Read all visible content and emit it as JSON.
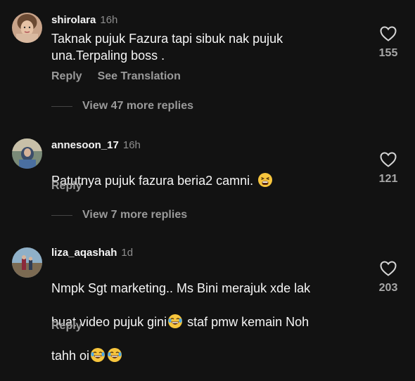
{
  "comments": [
    {
      "username": "shirolara",
      "time": "16h",
      "text": "Taknak pujuk Fazura tapi sibuk nak pujuk\nuna.Terpaling boss .",
      "actions": {
        "reply": "Reply",
        "translate": "See Translation"
      },
      "likes": "155",
      "view_more": "View 47 more replies"
    },
    {
      "username": "annesoon_17",
      "time": "16h",
      "text_parts": [
        "Patutnya pujuk fazura beria2 camni. "
      ],
      "emojis": [
        "tired-face-emoji"
      ],
      "actions": {
        "reply": "Reply"
      },
      "likes": "121",
      "view_more": "View 7 more replies"
    },
    {
      "username": "liza_aqashah",
      "time": "1d",
      "text_parts": [
        "Nmpk Sgt marketing.. Ms Bini merajuk xde lak",
        "buat video pujuk gini",
        " staf pmw kemain Noh",
        "tahh oi"
      ],
      "emojis": [
        "laughing-tears-emoji"
      ],
      "actions": {
        "reply": "Reply"
      },
      "likes": "203"
    }
  ],
  "colors": {
    "background": "#121212",
    "text": "#f5f5f5",
    "muted": "#8e8e8e"
  },
  "icons": [
    "heart-outline-icon"
  ]
}
